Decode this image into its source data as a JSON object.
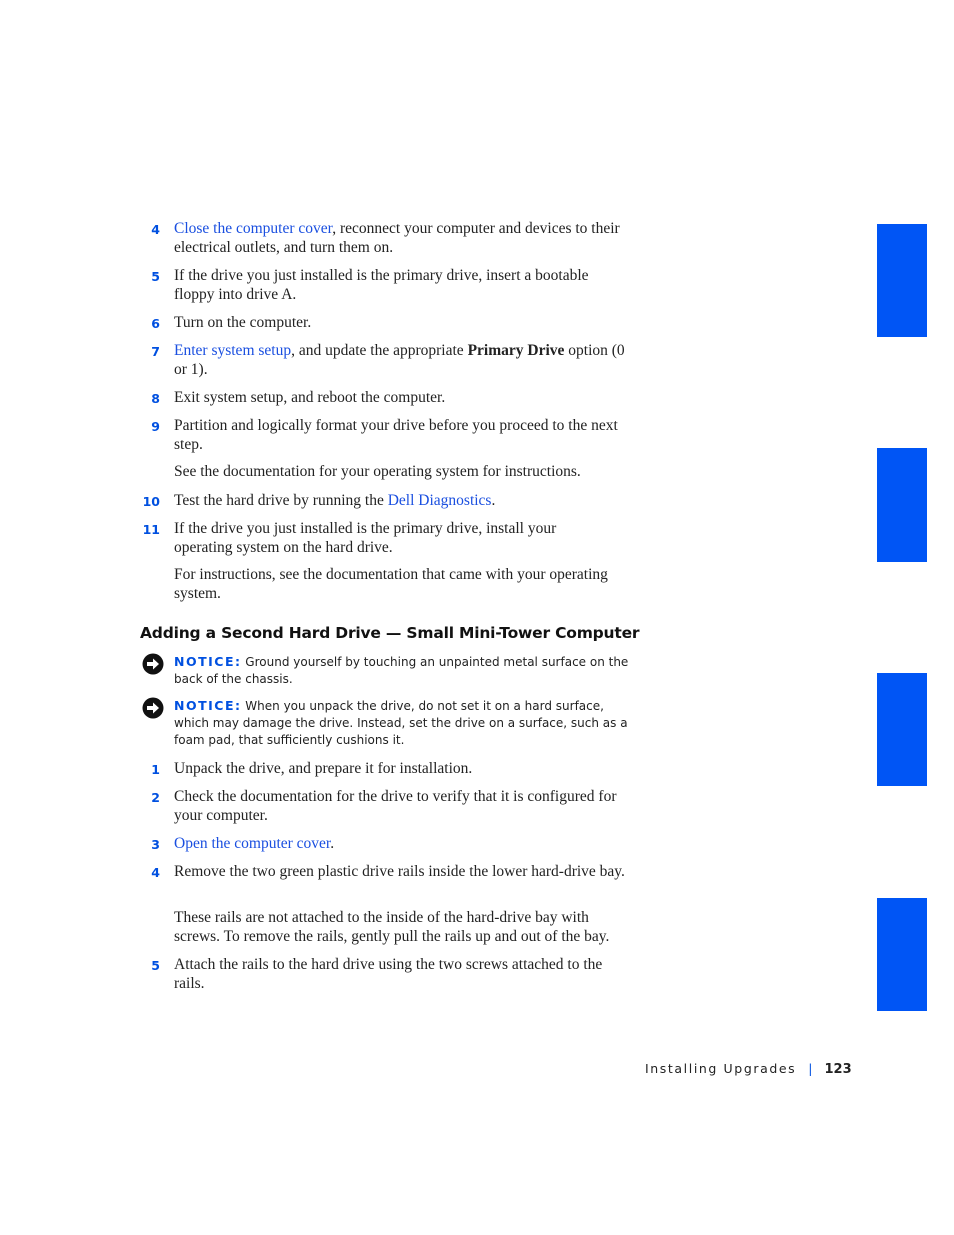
{
  "steps_top": [
    {
      "num": "4",
      "link": "Close the computer cover",
      "after": ", reconnect your computer and devices to their electrical outlets, and turn them on."
    },
    {
      "num": "5",
      "text": "If the drive you just installed is the primary drive, insert a bootable floppy into drive A."
    },
    {
      "num": "6",
      "text": "Turn on the computer."
    },
    {
      "num": "7",
      "link": "Enter system setup",
      "middle": ", and update the appropriate ",
      "bold": "Primary Drive",
      "after": " option (0 or 1)."
    },
    {
      "num": "8",
      "text": "Exit system setup, and reboot the computer."
    },
    {
      "num": "9",
      "text": "Partition and logically format your drive before you proceed to the next step."
    },
    {
      "num": "10",
      "before": "Test the hard drive by running the ",
      "link": "Dell Diagnostics",
      "after": "."
    },
    {
      "num": "11",
      "text": "If the drive you just installed is the primary drive, install your operating system on the hard drive."
    }
  ],
  "paras_top": [
    "See the documentation for your operating system for instructions.",
    "For instructions, see the documentation that came with your operating system."
  ],
  "heading": "Adding a Second Hard Drive — Small Mini-Tower Computer",
  "notices": [
    {
      "label": "NOTICE:",
      "text": " Ground yourself by touching an unpainted metal surface on the back of the chassis."
    },
    {
      "label": "NOTICE:",
      "text": " When you unpack the drive, do not set it on a hard surface, which may damage the drive. Instead, set the drive on a surface, such as a foam pad, that sufficiently cushions it."
    }
  ],
  "steps_bottom": [
    {
      "num": "1",
      "text": "Unpack the drive, and prepare it for installation."
    },
    {
      "num": "2",
      "text": "Check the documentation for the drive to verify that it is configured for your computer."
    },
    {
      "num": "3",
      "link": "Open the computer cover",
      "after": "."
    },
    {
      "num": "4",
      "text": "Remove the two green plastic drive rails inside the lower hard-drive bay."
    },
    {
      "num": "5",
      "text": "Attach the rails to the hard drive using the two screws attached to the rails."
    }
  ],
  "paras_bottom": [
    "These rails are not attached to the inside of the hard-drive bay with screws. To remove the rails, gently pull the rails up and out of the bay."
  ],
  "footer": {
    "section": "Installing Upgrades",
    "separator": "|",
    "page": "123"
  },
  "colors": {
    "accent": "#0055f5",
    "link": "#1a4fe0"
  }
}
